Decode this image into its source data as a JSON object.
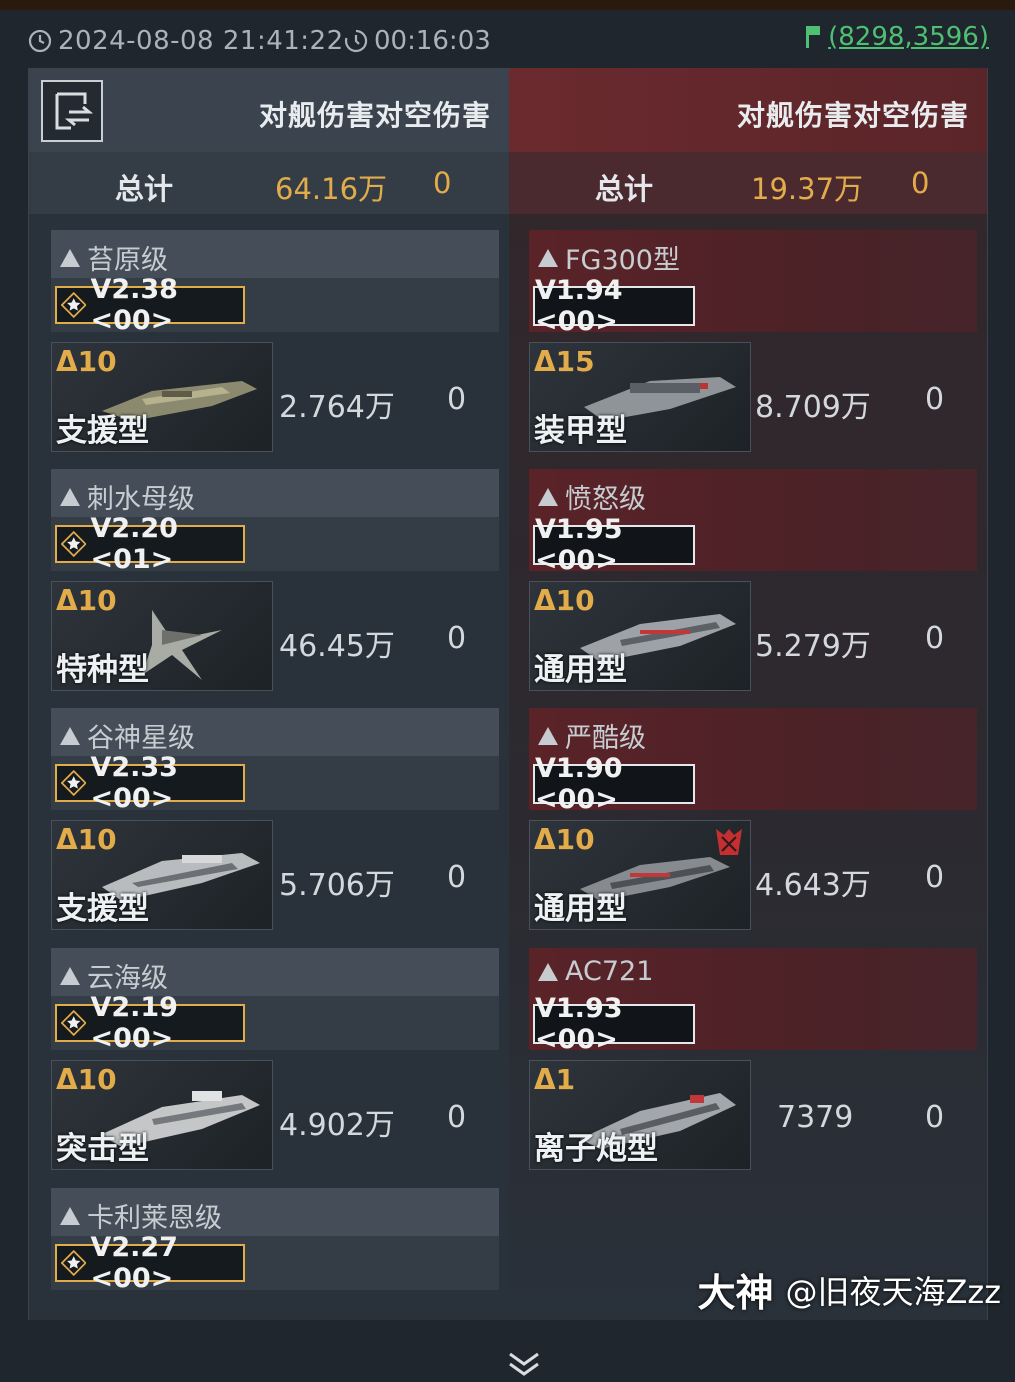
{
  "status": {
    "datetime": "2024-08-08 21:41:22",
    "timer": "00:16:03",
    "coords": "(8298,3596)"
  },
  "header": {
    "left_title": "对舰伤害对空伤害",
    "right_title": "对舰伤害对空伤害"
  },
  "totals": {
    "label": "总计",
    "left_ship": "64.16万",
    "left_air": "0",
    "right_ship": "19.37万",
    "right_air": "0"
  },
  "left_entries": [
    {
      "cls": "苔原级",
      "version": "V2.38 <00>",
      "level": "Δ10",
      "type": "支援型",
      "ship_dmg": "2.764万",
      "air_dmg": "0"
    },
    {
      "cls": "刺水母级",
      "version": "V2.20 <01>",
      "level": "Δ10",
      "type": "特种型",
      "ship_dmg": "46.45万",
      "air_dmg": "0"
    },
    {
      "cls": "谷神星级",
      "version": "V2.33 <00>",
      "level": "Δ10",
      "type": "支援型",
      "ship_dmg": "5.706万",
      "air_dmg": "0"
    },
    {
      "cls": "云海级",
      "version": "V2.19 <00>",
      "level": "Δ10",
      "type": "突击型",
      "ship_dmg": "4.902万",
      "air_dmg": "0"
    },
    {
      "cls": "卡利莱恩级",
      "version": "V2.27 <00>"
    }
  ],
  "right_entries": [
    {
      "cls": "FG300型",
      "version": "V1.94 <00>",
      "level": "Δ15",
      "type": "装甲型",
      "ship_dmg": "8.709万",
      "air_dmg": "0"
    },
    {
      "cls": "愤怒级",
      "version": "V1.95 <00>",
      "level": "Δ10",
      "type": "通用型",
      "ship_dmg": "5.279万",
      "air_dmg": "0"
    },
    {
      "cls": "严酷级",
      "version": "V1.90 <00>",
      "level": "Δ10",
      "type": "通用型",
      "ship_dmg": "4.643万",
      "air_dmg": "0"
    },
    {
      "cls": "AC721",
      "version": "V1.93 <00>",
      "level": "Δ1",
      "type": "离子炮型",
      "ship_dmg": "7379",
      "air_dmg": "0"
    }
  ],
  "watermark": {
    "brand": "大神",
    "user": "@旧夜天海Zzz"
  },
  "colors": {
    "gold": "#e3ac4a",
    "green": "#4fbf73",
    "enemy_red": "#6b2a2e"
  }
}
